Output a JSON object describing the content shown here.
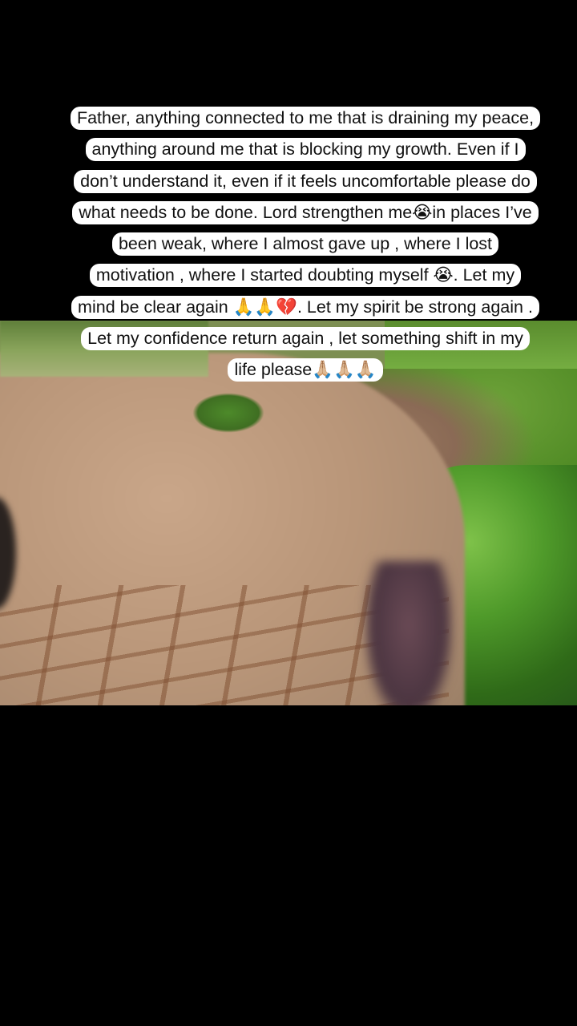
{
  "caption": {
    "lines": [
      "Father, anything connected to me that is draining my peace,",
      "anything around me that is blocking my growth. Even if I",
      "don’t understand it, even if it feels uncomfortable please do",
      "what needs to be done. Lord strengthen me😭in places I’ve",
      "been weak, where I almost gave up , where I lost",
      "motivation , where I started doubting myself 😭. Let my",
      "mind be clear again 🙏🙏💔. Let my spirit be strong again .",
      "Let my confidence return again , let something shift in my",
      "life please🙏🏼🙏🏼🙏🏼"
    ]
  },
  "colors": {
    "background": "#000000",
    "caption_bg": "#ffffff",
    "caption_text": "#111111"
  }
}
